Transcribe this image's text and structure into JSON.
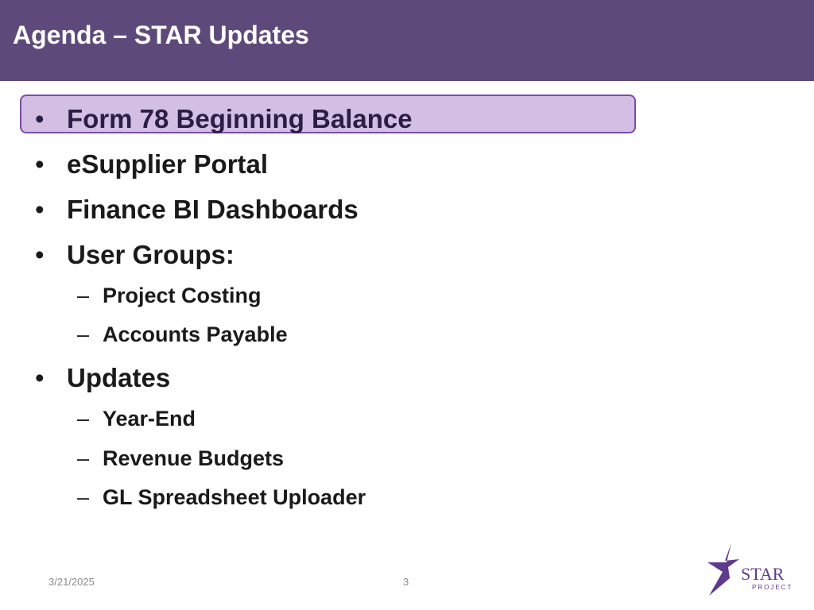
{
  "header": {
    "title": "Agenda – STAR Updates"
  },
  "agenda": {
    "items": [
      {
        "marker": "•",
        "label": "Form 78 Beginning Balance"
      },
      {
        "marker": "•",
        "label": "eSupplier Portal"
      },
      {
        "marker": "•",
        "label": "Finance BI Dashboards"
      },
      {
        "marker": "•",
        "label": "User Groups:"
      },
      {
        "marker": "–",
        "label": "Project Costing"
      },
      {
        "marker": "–",
        "label": "Accounts Payable"
      },
      {
        "marker": "•",
        "label": "Updates"
      },
      {
        "marker": "–",
        "label": "Year-End"
      },
      {
        "marker": "–",
        "label": "Revenue Budgets"
      },
      {
        "marker": "–",
        "label": "GL Spreadsheet Uploader"
      }
    ]
  },
  "footer": {
    "date": "3/21/2025",
    "page": "3"
  },
  "logo": {
    "text": "STAR",
    "subtext": "PROJECT",
    "icon": "star-logo-icon",
    "color": "#5e3a8c"
  },
  "colors": {
    "header": "#5e4a7a",
    "highlight_fill": "#d2bfe3",
    "highlight_border": "#7b4ca8"
  }
}
